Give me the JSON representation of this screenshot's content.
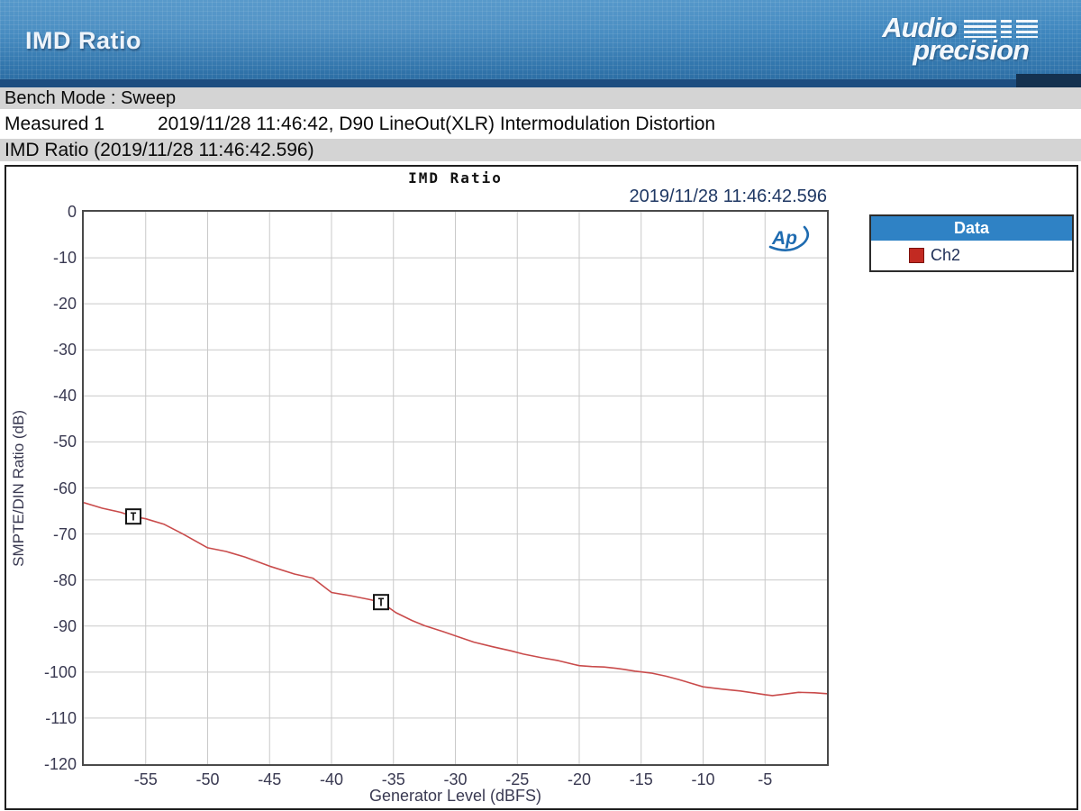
{
  "banner": {
    "title": "IMD Ratio",
    "logo_line1": "Audio",
    "logo_line2": "precision"
  },
  "rows": {
    "bench_mode": "Bench Mode : Sweep",
    "measured_label": "Measured 1",
    "measured_value": "2019/11/28 11:46:42, D90 LineOut(XLR) Intermodulation Distortion",
    "result_title": "IMD Ratio (2019/11/28 11:46:42.596)"
  },
  "chart": {
    "title": "IMD Ratio",
    "timestamp": "2019/11/28 11:46:42.596",
    "ap_mark": "Ap",
    "legend": {
      "header": "Data",
      "series": "Ch2",
      "swatch_color": "#c22a22"
    }
  },
  "chart_data": {
    "type": "line",
    "title": "IMD Ratio",
    "xlabel": "Generator Level (dBFS)",
    "ylabel": "SMPTE/DIN Ratio (dB)",
    "xlim": [
      -60,
      0
    ],
    "ylim": [
      -120,
      0
    ],
    "x_ticks": [
      -55,
      -50,
      -45,
      -40,
      -35,
      -30,
      -25,
      -20,
      -15,
      -10,
      -5
    ],
    "y_ticks": [
      0,
      -10,
      -20,
      -30,
      -40,
      -50,
      -60,
      -70,
      -80,
      -90,
      -100,
      -110,
      -120
    ],
    "grid": true,
    "legend_position": "outside-top-right",
    "series": [
      {
        "name": "Ch2",
        "color": "#c94b4b",
        "x": [
          -60,
          -58.5,
          -57,
          -56,
          -55,
          -53.5,
          -52,
          -50,
          -48.5,
          -47,
          -45,
          -43,
          -41.5,
          -40,
          -38.5,
          -37,
          -36,
          -34.8,
          -33.5,
          -32.5,
          -31,
          -29.7,
          -28.5,
          -27,
          -25.5,
          -24.5,
          -23,
          -21.7,
          -20.5,
          -20,
          -19,
          -18,
          -17,
          -16.4,
          -15.5,
          -14.2,
          -13,
          -12,
          -11,
          -10,
          -8.5,
          -7,
          -6,
          -5,
          -4.4,
          -3.5,
          -2.3,
          -1,
          0
        ],
        "y": [
          -63.2,
          -64.4,
          -65.3,
          -66.2,
          -66.7,
          -67.9,
          -70.0,
          -73.0,
          -73.8,
          -75.0,
          -77.0,
          -78.7,
          -79.6,
          -82.7,
          -83.4,
          -84.2,
          -84.8,
          -87.1,
          -88.8,
          -89.9,
          -91.2,
          -92.4,
          -93.5,
          -94.5,
          -95.4,
          -96.1,
          -96.9,
          -97.5,
          -98.3,
          -98.6,
          -98.8,
          -98.9,
          -99.2,
          -99.4,
          -99.8,
          -100.2,
          -100.9,
          -101.6,
          -102.4,
          -103.2,
          -103.7,
          -104.1,
          -104.5,
          -104.9,
          -105.1,
          -104.8,
          -104.4,
          -104.5,
          -104.7
        ]
      }
    ],
    "markers": [
      {
        "label": "T",
        "x": -56,
        "y": -66.2
      },
      {
        "label": "T",
        "x": -36,
        "y": -84.8
      }
    ]
  }
}
